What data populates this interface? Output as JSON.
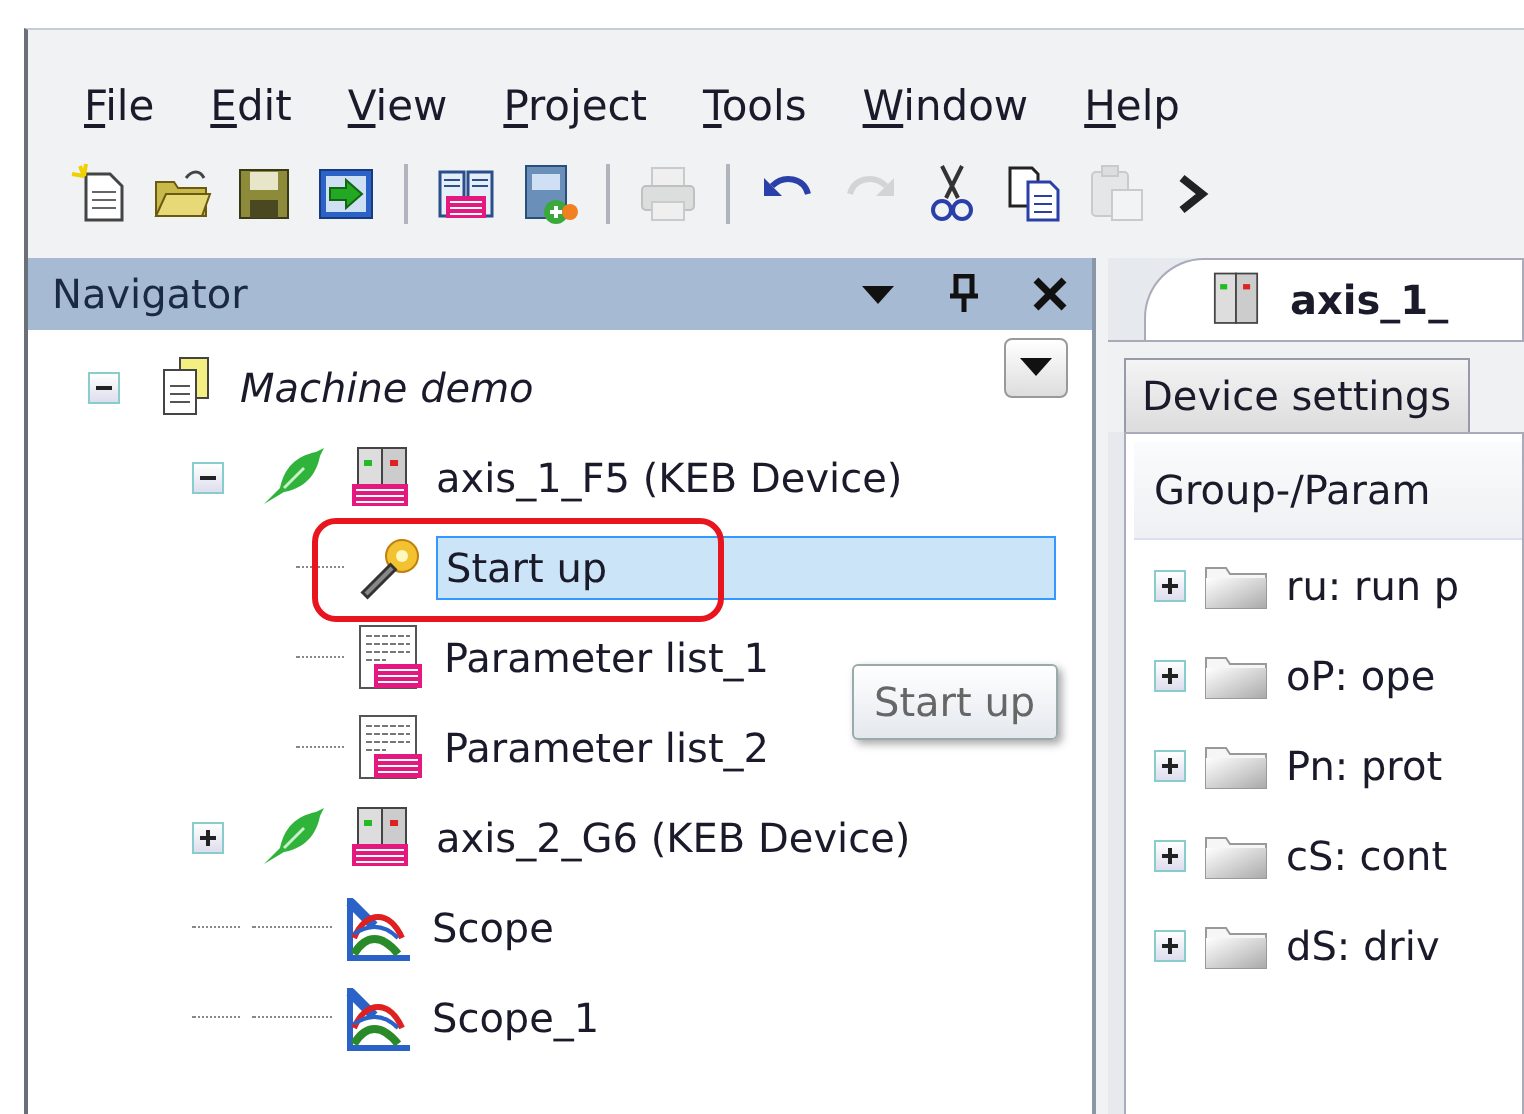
{
  "menu": [
    {
      "label": "File"
    },
    {
      "label": "Edit"
    },
    {
      "label": "View"
    },
    {
      "label": "Project"
    },
    {
      "label": "Tools"
    },
    {
      "label": "Window"
    },
    {
      "label": "Help"
    }
  ],
  "toolbar": [
    {
      "kind": "new",
      "disabled": false
    },
    {
      "kind": "open",
      "disabled": false
    },
    {
      "kind": "save",
      "disabled": false
    },
    {
      "kind": "import",
      "disabled": false
    },
    {
      "kind": "separator"
    },
    {
      "kind": "book",
      "disabled": false
    },
    {
      "kind": "addfile",
      "disabled": false
    },
    {
      "kind": "separator"
    },
    {
      "kind": "print",
      "disabled": true
    },
    {
      "kind": "separator"
    },
    {
      "kind": "undo",
      "disabled": false
    },
    {
      "kind": "redo",
      "disabled": true
    },
    {
      "kind": "cut",
      "disabled": false
    },
    {
      "kind": "copy",
      "disabled": false
    },
    {
      "kind": "paste",
      "disabled": true
    },
    {
      "kind": "more",
      "disabled": false
    }
  ],
  "navigator": {
    "title": "Navigator",
    "tooltip": "Start up",
    "tree": [
      {
        "label": "Machine demo",
        "kind": "project",
        "expanded": true,
        "children": [
          {
            "label": "axis_1_F5 (KEB Device)",
            "kind": "device",
            "expanded": true,
            "children": [
              {
                "label": "Start up",
                "kind": "wizard",
                "selected": true,
                "highlighted": true
              },
              {
                "label": "Parameter list_1",
                "kind": "paramlist",
                "selected": false,
                "highlighted": false
              },
              {
                "label": "Parameter list_2",
                "kind": "paramlist",
                "selected": false,
                "highlighted": false
              }
            ]
          },
          {
            "label": "axis_2_G6 (KEB Device)",
            "kind": "device",
            "expanded": false
          },
          {
            "label": "Scope",
            "kind": "scope",
            "selected": false
          },
          {
            "label": "Scope_1",
            "kind": "scope",
            "selected": false
          }
        ]
      }
    ]
  },
  "editor": {
    "document_tab": "axis_1_",
    "tabs": [
      {
        "label": "Device settings",
        "selected": false
      }
    ],
    "column_header": "Group-/Param",
    "groups": [
      {
        "label": "ru: run p",
        "expanded": false
      },
      {
        "label": "oP: ope",
        "expanded": false
      },
      {
        "label": "Pn: prot",
        "expanded": false
      },
      {
        "label": "cS: cont",
        "expanded": false
      },
      {
        "label": "dS: driv",
        "expanded": false
      }
    ]
  }
}
